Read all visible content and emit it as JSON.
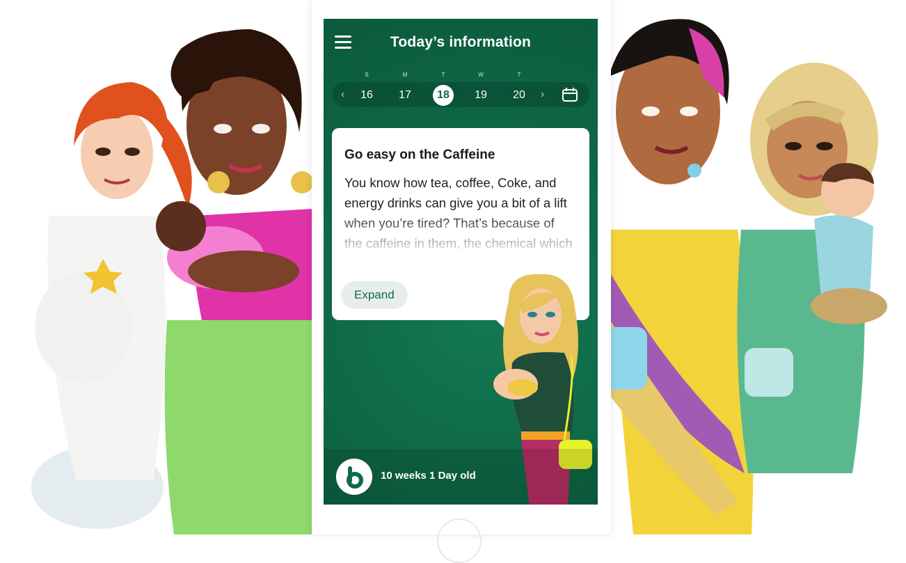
{
  "header": {
    "title": "Today’s information"
  },
  "week": {
    "letters": [
      "S",
      "M",
      "T",
      "W",
      "T"
    ],
    "days": [
      "16",
      "17",
      "18",
      "19",
      "20"
    ],
    "selected": "18",
    "prev_icon": "chevron-left-icon",
    "next_icon": "chevron-right-icon",
    "calendar_icon": "calendar-icon"
  },
  "card": {
    "title": "Go easy on the Caffeine",
    "body": "You know how tea, coffee, Coke, and energy drinks can give you a bit of a lift when you’re tired? That’s because of the caffeine in them, the chemical which makes",
    "expand_label": "Expand"
  },
  "footer": {
    "age_text": "10 weeks 1 Day old",
    "logo_icon": "baby-app-logo-icon"
  },
  "colors": {
    "primary": "#0f6a47",
    "card": "#ffffff",
    "expand_bg": "#e7eeea"
  }
}
